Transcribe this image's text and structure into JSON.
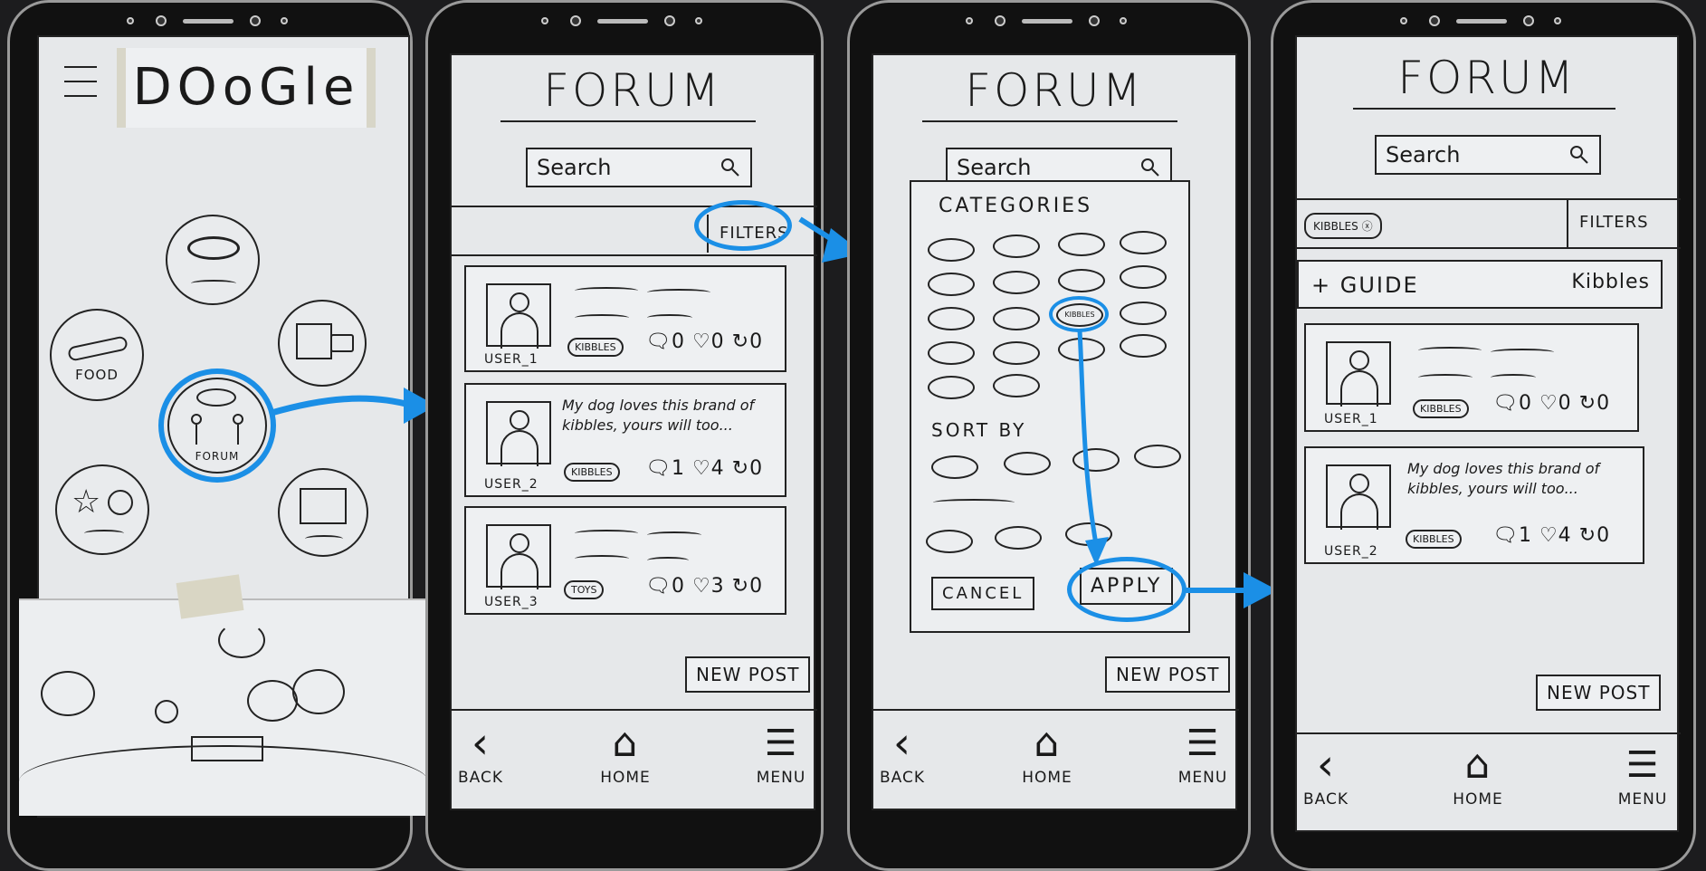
{
  "screen1": {
    "logo": "DOoGle",
    "food_label": "FOOD",
    "forum_label": "FORUM"
  },
  "screen2": {
    "title": "FORUM",
    "search_placeholder": "Search",
    "filters_label": "FILTERS",
    "posts": [
      {
        "user": "USER_1",
        "tag": "KIBBLES",
        "comments": "0",
        "likes": "0",
        "shares": "0"
      },
      {
        "user": "USER_2",
        "tag": "KIBBLES",
        "text": "My dog loves this brand of kibbles, yours will too...",
        "comments": "1",
        "likes": "4",
        "shares": "0"
      },
      {
        "user": "USER_3",
        "tag": "TOYS",
        "comments": "0",
        "likes": "3",
        "shares": "0"
      }
    ],
    "new_post_label": "NEW POST",
    "nav": {
      "back": "BACK",
      "home": "HOME",
      "menu": "MENU"
    }
  },
  "screen3": {
    "title": "FORUM",
    "search_placeholder": "Search",
    "categories_heading": "CATEGORIES",
    "selected_category": "KIBBLES",
    "sort_by_heading": "SORT BY",
    "cancel_label": "CANCEL",
    "apply_label": "APPLY",
    "new_post_label": "NEW POST",
    "nav": {
      "back": "BACK",
      "home": "HOME",
      "menu": "MENU"
    }
  },
  "screen4": {
    "title": "FORUM",
    "search_placeholder": "Search",
    "active_filter_chip": "KIBBLES",
    "filters_label": "FILTERS",
    "guide_label": "+ GUIDE",
    "guide_topic": "Kibbles",
    "posts": [
      {
        "user": "USER_1",
        "tag": "KIBBLES",
        "comments": "0",
        "likes": "0",
        "shares": "0"
      },
      {
        "user": "USER_2",
        "tag": "KIBBLES",
        "text": "My dog loves this brand of kibbles, yours will too...",
        "comments": "1",
        "likes": "4",
        "shares": "0"
      }
    ],
    "new_post_label": "NEW POST",
    "nav": {
      "back": "BACK",
      "home": "HOME",
      "menu": "MENU"
    }
  },
  "colors": {
    "annotation": "#1b8fe6",
    "paper": "#e6e8ea",
    "ink": "#1a1a1a"
  }
}
